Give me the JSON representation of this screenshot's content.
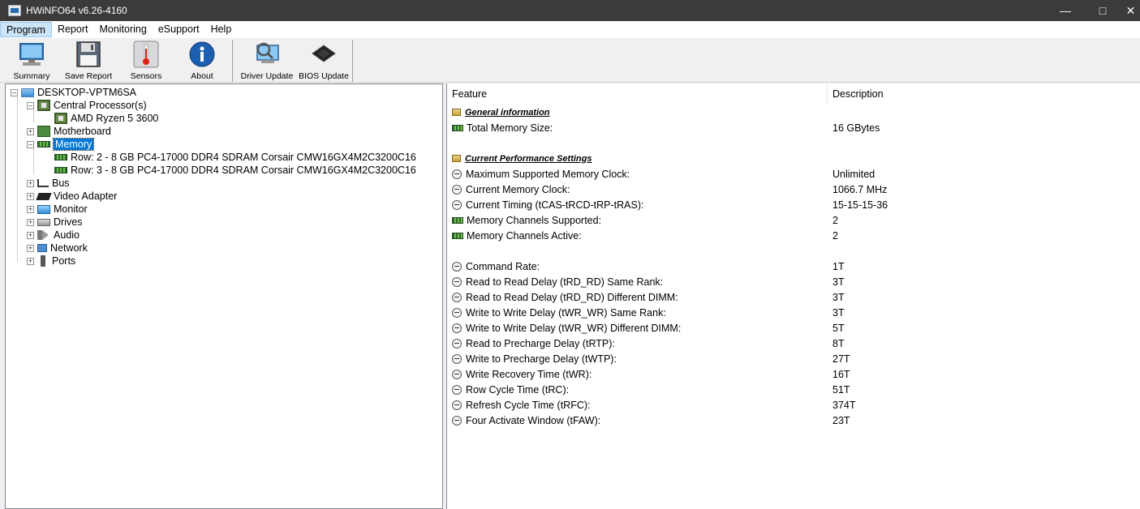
{
  "window": {
    "title": "HWiNFO64 v6.26-4160"
  },
  "menu": [
    "Program",
    "Report",
    "Monitoring",
    "eSupport",
    "Help"
  ],
  "toolbar": {
    "summary": "Summary",
    "save_report": "Save Report",
    "sensors": "Sensors",
    "about": "About",
    "driver_update": "Driver Update",
    "bios_update": "BIOS Update"
  },
  "tree": {
    "root": "DESKTOP-VPTM6SA",
    "cpu": "Central Processor(s)",
    "cpu_item": "AMD Ryzen 5 3600",
    "motherboard": "Motherboard",
    "memory": "Memory",
    "mem_row2": "Row: 2 - 8 GB PC4-17000 DDR4 SDRAM Corsair CMW16GX4M2C3200C16",
    "mem_row3": "Row: 3 - 8 GB PC4-17000 DDR4 SDRAM Corsair CMW16GX4M2C3200C16",
    "bus": "Bus",
    "video": "Video Adapter",
    "monitor": "Monitor",
    "drives": "Drives",
    "audio": "Audio",
    "network": "Network",
    "ports": "Ports"
  },
  "details": {
    "col_feature": "Feature",
    "col_description": "Description",
    "section_general": "General information",
    "total_memory_label": "Total Memory Size:",
    "total_memory_value": "16 GBytes",
    "section_perf": "Current Performance Settings",
    "rows": [
      {
        "label": "Maximum Supported Memory Clock:",
        "value": "Unlimited",
        "icon": "clock"
      },
      {
        "label": "Current Memory Clock:",
        "value": "1066.7 MHz",
        "icon": "clock"
      },
      {
        "label": "Current Timing (tCAS-tRCD-tRP-tRAS):",
        "value": "15-15-15-36",
        "icon": "clock"
      },
      {
        "label": "Memory Channels Supported:",
        "value": "2",
        "icon": "memory"
      },
      {
        "label": "Memory Channels Active:",
        "value": "2",
        "icon": "memory"
      }
    ],
    "timings": [
      {
        "label": "Command Rate:",
        "value": "1T"
      },
      {
        "label": "Read to Read Delay (tRD_RD) Same Rank:",
        "value": "3T"
      },
      {
        "label": "Read to Read Delay (tRD_RD) Different DIMM:",
        "value": "3T"
      },
      {
        "label": "Write to Write Delay (tWR_WR) Same Rank:",
        "value": "3T"
      },
      {
        "label": "Write to Write Delay (tWR_WR) Different DIMM:",
        "value": "5T"
      },
      {
        "label": "Read to Precharge Delay (tRTP):",
        "value": "8T"
      },
      {
        "label": "Write to Precharge Delay (tWTP):",
        "value": "27T"
      },
      {
        "label": "Write Recovery Time (tWR):",
        "value": "16T"
      },
      {
        "label": "Row Cycle Time (tRC):",
        "value": "51T"
      },
      {
        "label": "Refresh Cycle Time (tRFC):",
        "value": "374T"
      },
      {
        "label": "Four Activate Window (tFAW):",
        "value": "23T"
      }
    ]
  }
}
